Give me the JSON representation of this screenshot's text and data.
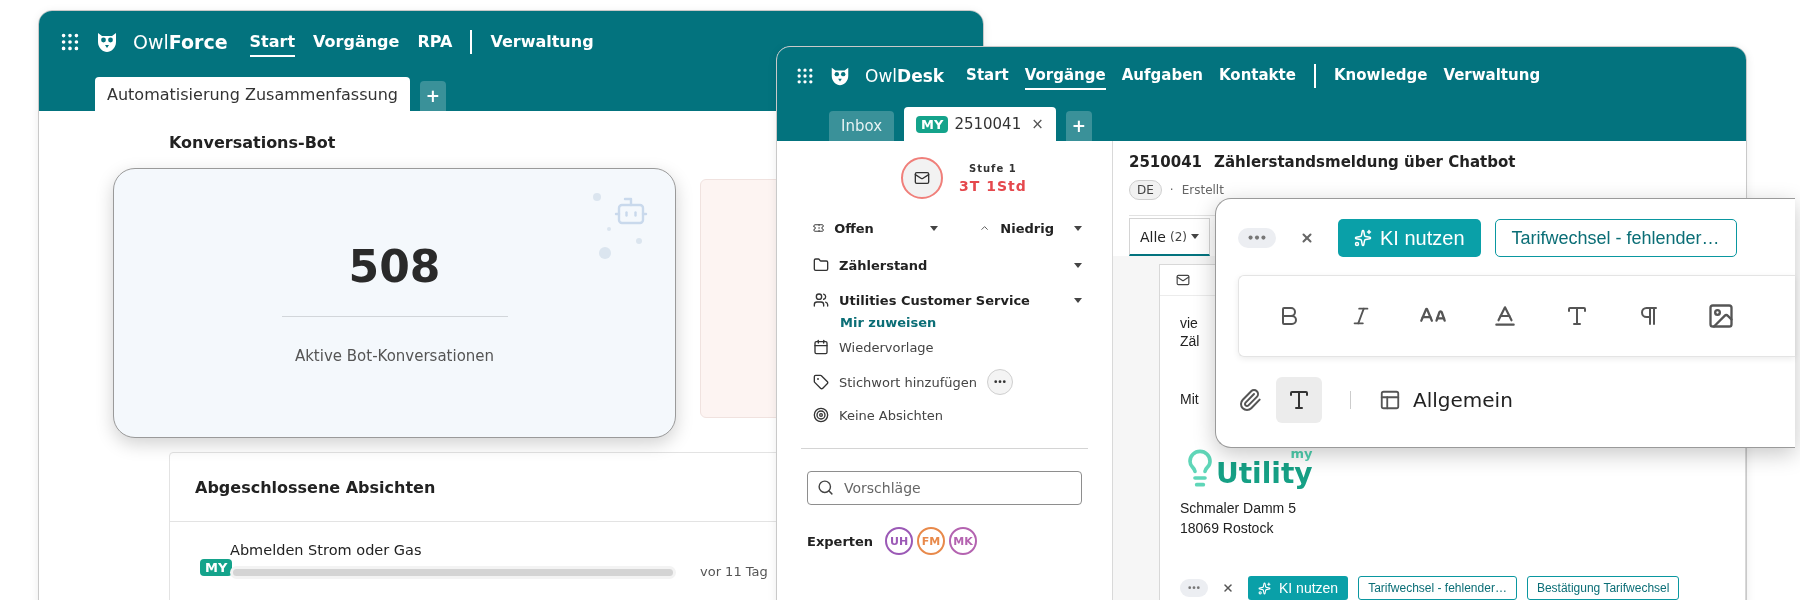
{
  "owlforce": {
    "brand_prefix": "Owl",
    "brand_suffix": "Force",
    "nav_groups": [
      {
        "items": [
          {
            "label": "Start",
            "selected": true
          },
          {
            "label": "Vorgänge",
            "selected": false
          },
          {
            "label": "RPA",
            "selected": false
          }
        ]
      },
      {
        "items": [
          {
            "label": "Verwaltung",
            "selected": false
          }
        ]
      }
    ],
    "tabs": [
      {
        "label": "Automatisierung Zusammenfassung",
        "selected": true
      }
    ],
    "add_tab": "+",
    "section_title": "Konversations-Bot",
    "stat": {
      "value": "508",
      "label": "Aktive Bot-Konversationen"
    },
    "intents": {
      "title": "Abgeschlossene Absichten",
      "rows": [
        {
          "badge": "MY",
          "name": "Abmelden Strom oder Gas",
          "level": 1,
          "time": "vor 11 Tag"
        }
      ]
    }
  },
  "owldesk": {
    "brand_prefix": "Owl",
    "brand_suffix": "Desk",
    "nav_groups": [
      {
        "items": [
          {
            "label": "Start",
            "selected": false
          },
          {
            "label": "Vorgänge",
            "selected": true
          },
          {
            "label": "Aufgaben",
            "selected": false
          },
          {
            "label": "Kontakte",
            "selected": false
          }
        ]
      },
      {
        "items": [
          {
            "label": "Knowledge",
            "selected": false
          },
          {
            "label": "Verwaltung",
            "selected": false
          }
        ]
      }
    ],
    "tabs": [
      {
        "label": "Inbox",
        "selected": false
      },
      {
        "badge": "MY",
        "label": "2510041",
        "close": "×",
        "selected": true
      }
    ],
    "add_tab": "+",
    "sidebar": {
      "level_label": "Stufe 1",
      "sla": "3T 1Std",
      "status": "Offen",
      "priority": "Niedrig",
      "category": "Zählerstand",
      "team": "Utilities Customer Service",
      "assign_link": "Mir zuweisen",
      "resubmission": "Wiedervorlage",
      "tag_action": "Stichwort hinzufügen",
      "intents": "Keine Absichten",
      "search_placeholder": "Vorschläge",
      "experts_label": "Experten",
      "experts": [
        {
          "initials": "UH",
          "color": "#9b59b6"
        },
        {
          "initials": "FM",
          "color": "#e8894a"
        },
        {
          "initials": "MK",
          "color": "#b463b0"
        }
      ]
    },
    "main": {
      "ticket_id": "2510041",
      "subject": "Zählerstandsmeldung über Chatbot",
      "language": "DE",
      "meta_separator": "·",
      "meta": "Erstellt",
      "filter": {
        "label": "Alle",
        "count": "(2)"
      },
      "mail_fragments": [
        "vie",
        "Zäl",
        "Mit"
      ],
      "logo": {
        "small": "my",
        "big": "Utility"
      },
      "address": [
        "Schmaler Damm 5",
        "18069 Rostock"
      ],
      "ai_button": "KI nutzen",
      "suggestions": [
        "Tarifwechsel - fehlender…",
        "Bestätigung Tarifwechsel"
      ]
    }
  },
  "popup": {
    "ai_button": "KI nutzen",
    "suggestions": [
      "Tarifwechsel - fehlender…"
    ],
    "format_toggle_selected": true,
    "template": "Allgemein"
  }
}
